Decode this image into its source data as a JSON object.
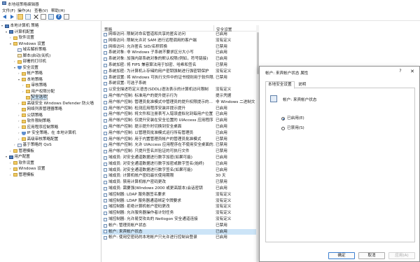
{
  "window": {
    "title": "本地组策略编辑器"
  },
  "menu": [
    "文件(F)",
    "操作(A)",
    "查看(V)",
    "帮助(H)"
  ],
  "nav": [
    {
      "label": "本地计算机 策略",
      "icon": "computer-icon",
      "exp": "▾",
      "indent": 0
    },
    {
      "label": "计算机配置",
      "icon": "computer-icon",
      "exp": "▾",
      "indent": 1
    },
    {
      "label": "软件设置",
      "icon": "folder-icon",
      "exp": "›",
      "indent": 2
    },
    {
      "label": "Windows 设置",
      "icon": "folder-icon",
      "exp": "▾",
      "indent": 2
    },
    {
      "label": "域名解析策略",
      "icon": "chart-icon",
      "exp": "",
      "indent": 3
    },
    {
      "label": "脚本(启动/关机)",
      "icon": "scroll-icon",
      "exp": "",
      "indent": 3
    },
    {
      "label": "部署的打印机",
      "icon": "folder-icon",
      "exp": "›",
      "indent": 3
    },
    {
      "label": "安全设置",
      "icon": "shield-icon",
      "exp": "▾",
      "indent": 3
    },
    {
      "label": "帐户策略",
      "icon": "folder-icon",
      "exp": "›",
      "indent": 4
    },
    {
      "label": "本地策略",
      "icon": "folder-icon",
      "exp": "▾",
      "indent": 4
    },
    {
      "label": "审核策略",
      "icon": "folder-icon",
      "exp": "›",
      "indent": 5
    },
    {
      "label": "用户权限分配",
      "icon": "folder-icon",
      "exp": "›",
      "indent": 5
    },
    {
      "label": "安全选项",
      "icon": "folder-icon",
      "exp": "",
      "indent": 5,
      "selected": true
    },
    {
      "label": "高级安全 Windows Defender 防火墙",
      "icon": "folder-icon",
      "exp": "›",
      "indent": 4
    },
    {
      "label": "网络列表管理器策略",
      "icon": "folder-icon",
      "exp": "",
      "indent": 4
    },
    {
      "label": "公钥策略",
      "icon": "folder-icon",
      "exp": "›",
      "indent": 4
    },
    {
      "label": "软件限制策略",
      "icon": "folder-icon",
      "exp": "›",
      "indent": 4
    },
    {
      "label": "应用程序控制策略",
      "icon": "folder-icon",
      "exp": "›",
      "indent": 4
    },
    {
      "label": "IP 安全策略，在 本地计算机",
      "icon": "shield-icon",
      "exp": "›",
      "indent": 4
    },
    {
      "label": "高级审核策略配置",
      "icon": "folder-icon",
      "exp": "›",
      "indent": 4
    },
    {
      "label": "基于策略的 QoS",
      "icon": "chart-icon",
      "exp": "›",
      "indent": 3
    },
    {
      "label": "管理模板",
      "icon": "folder-icon",
      "exp": "›",
      "indent": 2
    },
    {
      "label": "用户配置",
      "icon": "computer-icon",
      "exp": "▾",
      "indent": 1
    },
    {
      "label": "软件设置",
      "icon": "folder-icon",
      "exp": "›",
      "indent": 2
    },
    {
      "label": "Windows 设置",
      "icon": "folder-icon",
      "exp": "›",
      "indent": 2
    },
    {
      "label": "管理模板",
      "icon": "folder-icon",
      "exp": "›",
      "indent": 2
    }
  ],
  "columns": {
    "policy": "策略",
    "setting": "安全设置"
  },
  "policies": [
    {
      "name": "网络访问: 限制对命名管道和共享的匿名访问",
      "setting": "已启用"
    },
    {
      "name": "网络访问: 限制允许对 SAM 进行远程调用的客户端",
      "setting": "没有定义"
    },
    {
      "name": "网络访问: 允许匿名 SID/名称转换",
      "setting": "已禁用"
    },
    {
      "name": "系统对象: 非 Windows 子系统不要求区分大小写",
      "setting": "已启用"
    },
    {
      "name": "系统对象: 加强内部系统对象的默认权限(例如，符号链接)",
      "setting": "已启用"
    },
    {
      "name": "系统加密: 将 FIPS 兼容算法用于加密、哈希和签名",
      "setting": "已禁用"
    },
    {
      "name": "系统加密: 为计算机上存储的用户密钥强制进行强密钥保护",
      "setting": "没有定义"
    },
    {
      "name": "系统设置: 将 Windows 可执行文件中的证书规则用于软件限...",
      "setting": "已禁用"
    },
    {
      "name": "系统设置: 可选子系统",
      "setting": ""
    },
    {
      "name": "以安全描述符定义语言(SDDL)语法表示的计算机访问限制",
      "setting": "没有定义"
    },
    {
      "name": "用户帐户控制: 标准用户的提升提示行为",
      "setting": "提示凭据"
    },
    {
      "name": "用户帐户控制: 管理员批准模式中管理员的提升权限提示的...",
      "setting": "非 Windows 二进制文件..."
    },
    {
      "name": "用户帐户控制: 检测应用程序安装并提示提升",
      "setting": "已启用"
    },
    {
      "name": "用户帐户控制: 将文件和注册表写入错误虚拟化到每用户位置",
      "setting": "已启用"
    },
    {
      "name": "用户帐户控制: 仅提升安装在安全位置的 UIAccess 应用程序",
      "setting": "已启用"
    },
    {
      "name": "用户帐户控制: 提示提升时切换到安全桌面",
      "setting": "已启用"
    },
    {
      "name": "用户帐户控制: 以管理员批准模式运行所有管理员",
      "setting": "已启用"
    },
    {
      "name": "用户帐户控制: 用于内置管理员帐户的管理员批准模式",
      "setting": "已禁用"
    },
    {
      "name": "用户帐户控制: 允许 UIAccess 应用程序在不使用安全桌面的...",
      "setting": "已禁用"
    },
    {
      "name": "用户帐户控制: 只提升签名并验证的可执行文件",
      "setting": "已禁用"
    },
    {
      "name": "域成员: 对安全通道数据进行数字加密(如果可能)",
      "setting": "已启用"
    },
    {
      "name": "域成员: 对安全通道数据进行数字加密或数字签名(始终)",
      "setting": "已启用"
    },
    {
      "name": "域成员: 对安全通道数据进行数字签名(如果可能)",
      "setting": "已启用"
    },
    {
      "name": "域成员: 计算机帐户密码最长使用期限",
      "setting": "30 天"
    },
    {
      "name": "域成员: 禁用计算机帐户密码更改",
      "setting": "已禁用"
    },
    {
      "name": "域成员: 需要强(Windows 2000 或更高版本)会话密钥",
      "setting": "已启用"
    },
    {
      "name": "域控制器: LDAP 服务器签名要求",
      "setting": "没有定义"
    },
    {
      "name": "域控制器: LDAP 服务器通道绑定令牌要求",
      "setting": "没有定义"
    },
    {
      "name": "域控制器: 拒绝计算机帐户密码更改",
      "setting": "没有定义"
    },
    {
      "name": "域控制器: 允许服务器操作者计划任务",
      "setting": "没有定义"
    },
    {
      "name": "域控制器: 允许易受攻击的 Netlogon 安全通道连接",
      "setting": "没有定义"
    },
    {
      "name": "帐户: 管理员帐户状态",
      "setting": "已禁用"
    },
    {
      "name": "帐户: 来宾帐户状态",
      "setting": "已启用",
      "selected": true
    },
    {
      "name": "帐户: 使用空密码的本地帐户只允许进行控制台登录",
      "setting": "已启用"
    }
  ],
  "dialog": {
    "title": "帐户: 来宾帐户状态 属性",
    "help": "?",
    "close": "✕",
    "tabs": [
      "本地安全设置",
      "说明"
    ],
    "policy_name": "帐户: 来宾帐户状态",
    "options": [
      {
        "label": "已启用(E)",
        "checked": true
      },
      {
        "label": "已禁用(S)",
        "checked": false
      }
    ],
    "buttons": {
      "ok": "确定",
      "cancel": "取消",
      "apply": "应用(A)"
    }
  }
}
